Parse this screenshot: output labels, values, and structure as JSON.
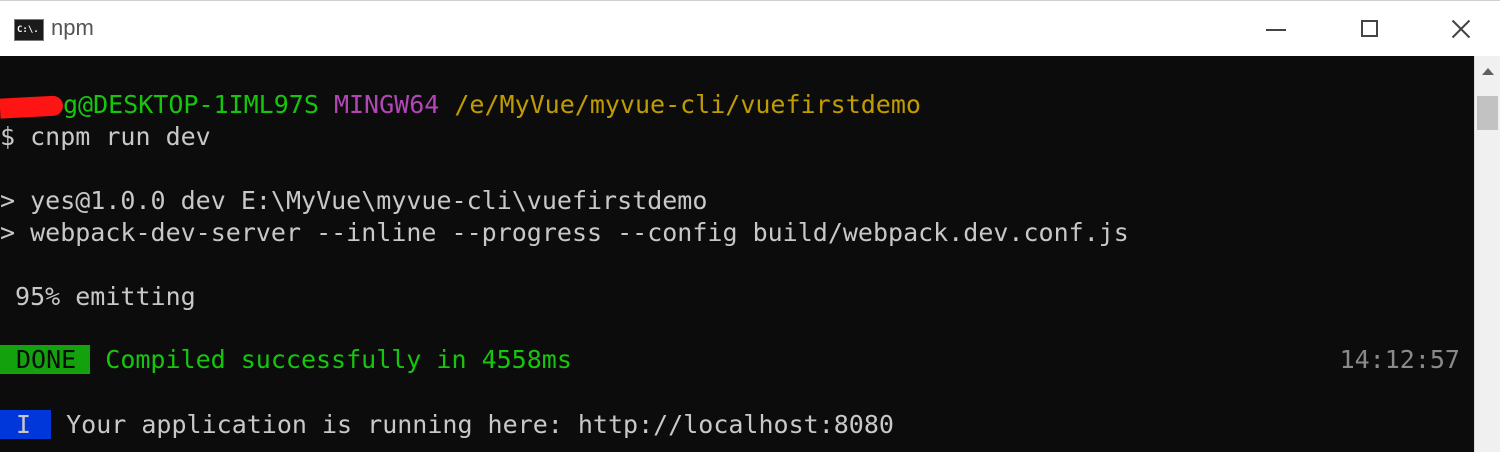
{
  "window": {
    "title": "npm",
    "icon_label": "C:\\.",
    "controls": [
      "minimize-icon",
      "maximize-icon",
      "close-icon"
    ]
  },
  "terminal": {
    "prompt": {
      "user_host": "g@DESKTOP-1IML97S",
      "env": "MINGW64",
      "path": "/e/MyVue/myvue-cli/vuefirstdemo"
    },
    "command": "$ cnpm run dev",
    "output": [
      "> yes@1.0.0 dev E:\\MyVue\\myvue-cli\\vuefirstdemo",
      "> webpack-dev-server --inline --progress --config build/webpack.dev.conf.js",
      " 95% emitting"
    ],
    "done": {
      "badge": "DONE",
      "message": "Compiled successfully in 4558ms",
      "time": "14:12:57"
    },
    "info": {
      "badge": "I",
      "message": "Your application is running here: http://localhost:8080"
    }
  },
  "colors": {
    "console_bg": "#0c0c0c",
    "green": "#16c60c",
    "magenta": "#b346b6",
    "yellow": "#c19c00",
    "done_badge": "#13a10e",
    "info_badge": "#0037da",
    "redaction": "#ff1414"
  }
}
